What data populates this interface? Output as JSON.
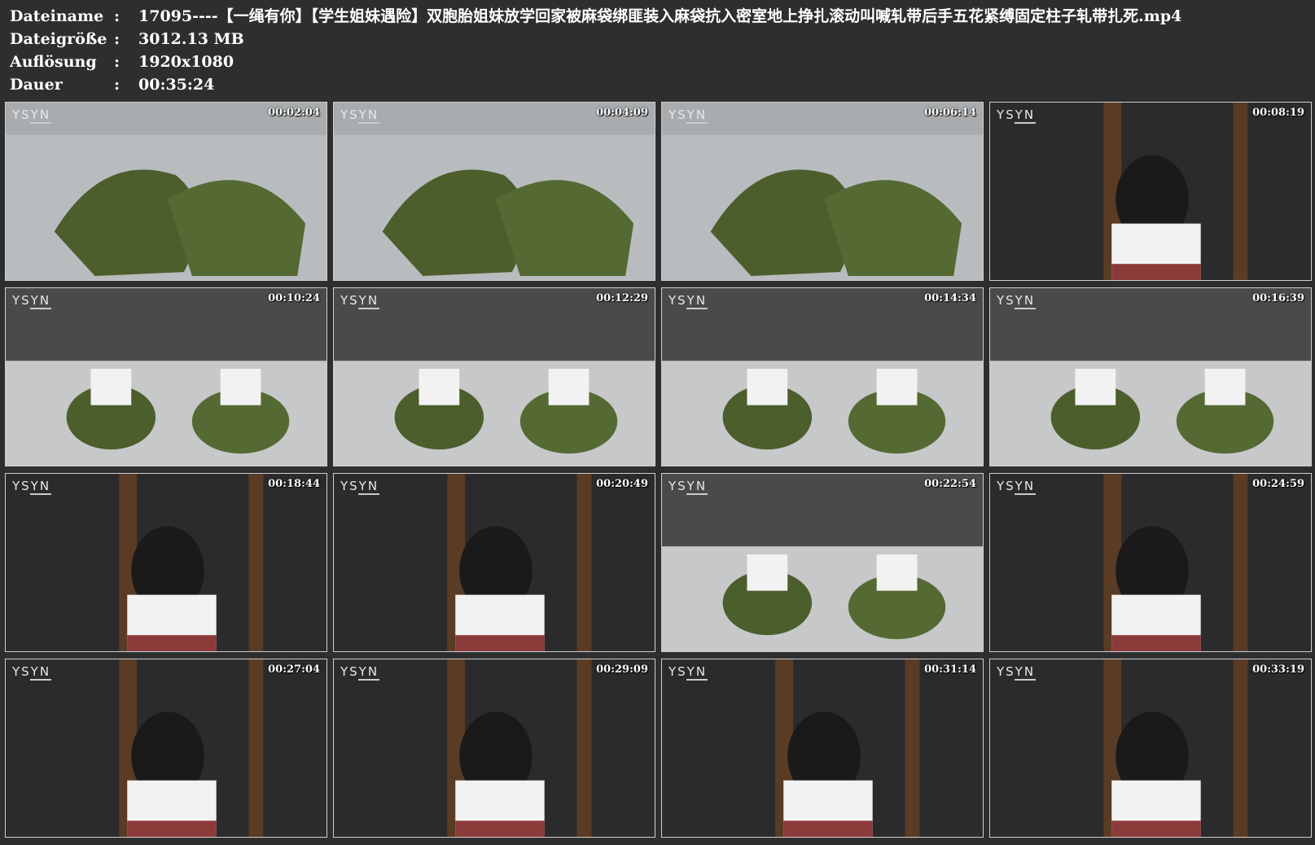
{
  "info": {
    "filename_label": "Dateiname",
    "filename_value": "17095----【一绳有你】【学生姐妹遇险】双胞胎姐妹放学回家被麻袋绑匪装入麻袋抗入密室地上挣扎滚动叫喊轧带后手五花紧缚固定柱子轧带扎死.mp4",
    "size_label": "Dateigröße",
    "size_value": "3012.13 MB",
    "resolution_label": "Auflösung",
    "resolution_value": "1920x1080",
    "duration_label": "Dauer",
    "duration_value": "00:35:24",
    "separator": ":"
  },
  "thumbnails": [
    {
      "time": "00:02:04",
      "scene": "floor-bag"
    },
    {
      "time": "00:04:09",
      "scene": "floor-bag"
    },
    {
      "time": "00:06:14",
      "scene": "floor-bag"
    },
    {
      "time": "00:08:19",
      "scene": "dark-room"
    },
    {
      "time": "00:10:24",
      "scene": "room-floor"
    },
    {
      "time": "00:12:29",
      "scene": "room-floor"
    },
    {
      "time": "00:14:34",
      "scene": "room-floor"
    },
    {
      "time": "00:16:39",
      "scene": "room-floor"
    },
    {
      "time": "00:18:44",
      "scene": "dark-room"
    },
    {
      "time": "00:20:49",
      "scene": "dark-room"
    },
    {
      "time": "00:22:54",
      "scene": "room-floor"
    },
    {
      "time": "00:24:59",
      "scene": "dark-room"
    },
    {
      "time": "00:27:04",
      "scene": "dark-room"
    },
    {
      "time": "00:29:09",
      "scene": "dark-room"
    },
    {
      "time": "00:31:14",
      "scene": "dark-room"
    },
    {
      "time": "00:33:19",
      "scene": "dark-room"
    }
  ],
  "watermark_icon": "ysyn-logo-icon",
  "colors": {
    "background": "#2e2e2e",
    "text": "#ffffff",
    "bag_green": "#4b5e2c",
    "floor_grey": "#b9bcbf",
    "wall_dark": "#2b2b2d"
  }
}
